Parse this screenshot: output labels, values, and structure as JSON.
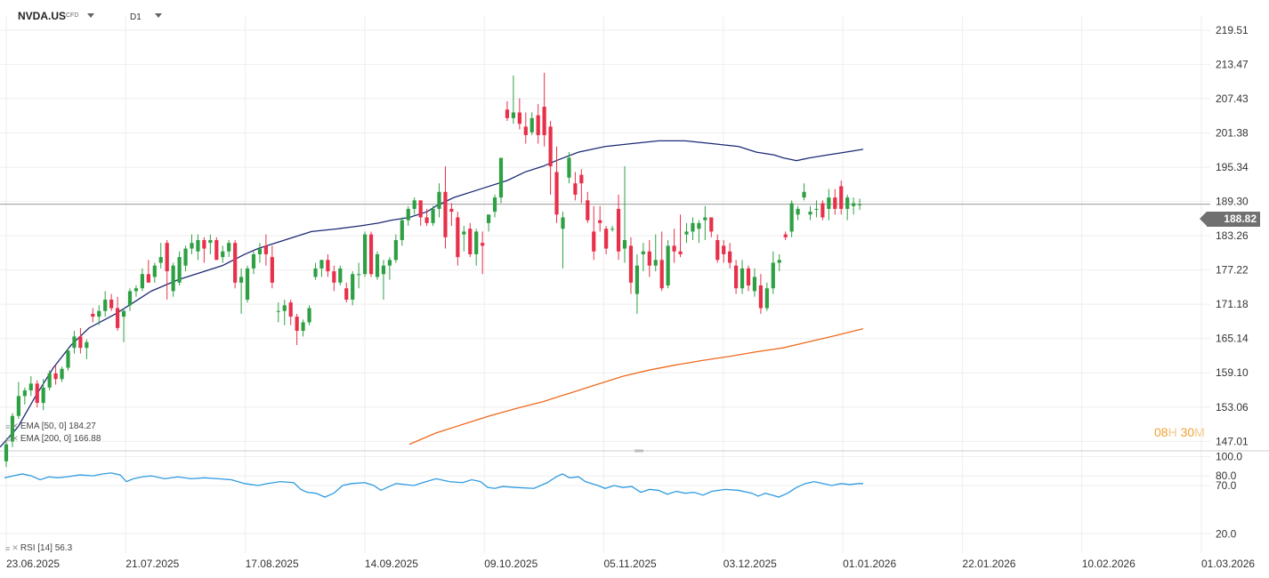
{
  "toolbar": {
    "symbol": "NVDA.US",
    "symbol_type": "CFD",
    "timeframe": "D1"
  },
  "colors": {
    "up": "#2ea043",
    "down": "#e8304a",
    "ema50": "#1c2a74",
    "ema200": "#ee6a1e",
    "rsi": "#2f9be0",
    "grid": "#eeeeee",
    "price_line": "#9a9a9a",
    "countdown": "#f0a030"
  },
  "icons": {
    "legend_drag": "lines-icon",
    "legend_remove": "close-icon",
    "dropdown": "caret-down-icon"
  },
  "legend": {
    "ema50": "EMA [50, 0]  184.27",
    "ema200": "EMA [200, 0]  166.88",
    "rsi": "RSI [14]  56.3"
  },
  "countdown": {
    "hours": "08",
    "hours_unit": "H",
    "minutes": "30",
    "minutes_unit": "M"
  },
  "current_price": "188.82",
  "chart_data": {
    "type": "candlestick",
    "title": "NVDA.US",
    "price_axis": {
      "ticks": [
        "219.51",
        "213.47",
        "207.43",
        "201.38",
        "195.34",
        "189.30",
        "183.26",
        "177.22",
        "171.18",
        "165.14",
        "159.10",
        "153.06",
        "147.01"
      ],
      "ylim": [
        145.5,
        222
      ]
    },
    "rsi_axis": {
      "ticks": [
        "100.0",
        "80.0",
        "70.0",
        "20.0"
      ],
      "ylim": [
        0,
        105
      ]
    },
    "x_axis": {
      "labels": [
        "23.06.2025",
        "21.07.2025",
        "17.08.2025",
        "14.09.2025",
        "09.10.2025",
        "05.11.2025",
        "03.12.2025",
        "01.01.2026",
        "22.01.2026",
        "10.02.2026",
        "01.03.2026"
      ]
    },
    "candles": [
      [
        143.5,
        147.0,
        142.5,
        146.5
      ],
      [
        147.0,
        152.0,
        146.0,
        151.5
      ],
      [
        151.5,
        157.5,
        151.0,
        155.0
      ],
      [
        155.0,
        156.5,
        153.5,
        156.0
      ],
      [
        156.0,
        158.5,
        155.0,
        157.2
      ],
      [
        157.2,
        157.8,
        153.0,
        153.8
      ],
      [
        153.8,
        158.0,
        152.5,
        156.5
      ],
      [
        156.5,
        159.5,
        156.0,
        159.0
      ],
      [
        159.0,
        160.5,
        157.0,
        158.0
      ],
      [
        158.0,
        160.2,
        157.5,
        159.8
      ],
      [
        160.0,
        163.5,
        159.5,
        163.0
      ],
      [
        163.5,
        166.5,
        162.5,
        165.5
      ],
      [
        165.5,
        167.0,
        162.5,
        163.5
      ],
      [
        163.5,
        165.0,
        161.5,
        164.5
      ],
      [
        169.5,
        170.5,
        168.0,
        169.0
      ],
      [
        169.0,
        171.0,
        167.5,
        170.0
      ],
      [
        170.0,
        173.5,
        169.0,
        172.0
      ],
      [
        172.0,
        173.0,
        170.0,
        170.5
      ],
      [
        170.5,
        172.5,
        166.5,
        167.0
      ],
      [
        169.0,
        170.5,
        164.5,
        170.0
      ],
      [
        171.0,
        174.0,
        170.0,
        173.5
      ],
      [
        173.5,
        174.5,
        172.5,
        174.0
      ],
      [
        174.0,
        177.5,
        173.5,
        176.5
      ],
      [
        176.5,
        179.0,
        175.5,
        175.0
      ],
      [
        176.0,
        178.5,
        175.0,
        178.0
      ],
      [
        178.5,
        182.0,
        177.5,
        179.5
      ],
      [
        182.0,
        182.5,
        172.0,
        177.0
      ],
      [
        173.5,
        178.5,
        172.5,
        178.0
      ],
      [
        175.0,
        180.5,
        174.5,
        179.5
      ],
      [
        178.0,
        181.5,
        177.0,
        181.0
      ],
      [
        181.0,
        183.5,
        180.0,
        182.0
      ],
      [
        180.5,
        183.5,
        179.0,
        182.5
      ],
      [
        182.5,
        183.0,
        178.5,
        181.0
      ],
      [
        182.0,
        183.5,
        180.0,
        182.5
      ],
      [
        182.5,
        183.0,
        179.0,
        179.0
      ],
      [
        179.5,
        181.5,
        178.5,
        180.5
      ],
      [
        180.5,
        182.5,
        179.5,
        182.0
      ],
      [
        182.0,
        182.5,
        174.0,
        175.0
      ],
      [
        175.0,
        177.5,
        169.5,
        176.0
      ],
      [
        172.0,
        178.0,
        171.5,
        177.5
      ],
      [
        177.5,
        180.5,
        176.5,
        180.0
      ],
      [
        180.0,
        182.0,
        178.5,
        181.0
      ],
      [
        181.5,
        183.5,
        178.0,
        180.0
      ],
      [
        179.5,
        181.5,
        174.0,
        175.0
      ],
      [
        170.0,
        171.5,
        168.0,
        170.0
      ],
      [
        170.0,
        172.0,
        167.5,
        171.0
      ],
      [
        171.5,
        172.0,
        167.5,
        169.0
      ],
      [
        169.0,
        169.5,
        164.0,
        166.5
      ],
      [
        166.5,
        168.5,
        165.5,
        168.0
      ],
      [
        168.0,
        171.0,
        167.5,
        170.5
      ],
      [
        176.0,
        178.5,
        175.5,
        177.5
      ],
      [
        177.5,
        179.0,
        176.0,
        179.0
      ],
      [
        179.0,
        180.0,
        176.0,
        177.0
      ],
      [
        177.0,
        178.0,
        173.5,
        175.0
      ],
      [
        175.0,
        178.0,
        174.5,
        177.5
      ],
      [
        174.0,
        175.0,
        171.5,
        172.0
      ],
      [
        172.0,
        177.0,
        171.0,
        176.5
      ],
      [
        176.5,
        178.5,
        174.0,
        176.5
      ],
      [
        176.5,
        184.0,
        176.0,
        183.5
      ],
      [
        183.5,
        184.0,
        176.0,
        176.5
      ],
      [
        176.0,
        180.5,
        175.5,
        180.0
      ],
      [
        176.5,
        179.0,
        172.0,
        178.0
      ],
      [
        178.0,
        179.5,
        175.5,
        179.0
      ],
      [
        179.0,
        183.5,
        178.5,
        182.5
      ],
      [
        182.5,
        186.5,
        181.5,
        186.0
      ],
      [
        186.0,
        188.5,
        185.0,
        188.0
      ],
      [
        188.0,
        190.0,
        187.0,
        189.5
      ],
      [
        189.5,
        189.5,
        185.0,
        186.5
      ],
      [
        186.5,
        188.0,
        185.0,
        185.5
      ],
      [
        185.5,
        188.5,
        185.0,
        188.0
      ],
      [
        188.0,
        192.5,
        186.5,
        191.0
      ],
      [
        191.0,
        195.5,
        181.0,
        183.0
      ],
      [
        188.0,
        189.0,
        185.0,
        187.5
      ],
      [
        186.5,
        187.5,
        178.0,
        179.5
      ],
      [
        183.5,
        185.0,
        180.5,
        184.0
      ],
      [
        184.5,
        185.5,
        179.5,
        180.0
      ],
      [
        180.0,
        184.5,
        178.0,
        184.0
      ],
      [
        182.0,
        184.0,
        176.5,
        181.5
      ],
      [
        185.5,
        187.0,
        184.0,
        187.0
      ],
      [
        187.5,
        190.5,
        186.5,
        190.0
      ],
      [
        190.0,
        197.0,
        189.0,
        197.0
      ],
      [
        205.5,
        207.0,
        203.5,
        204.0
      ],
      [
        204.0,
        211.5,
        203.0,
        205.0
      ],
      [
        205.0,
        207.5,
        202.0,
        203.0
      ],
      [
        202.5,
        205.0,
        199.5,
        201.0
      ],
      [
        201.5,
        205.0,
        201.0,
        204.0
      ],
      [
        204.5,
        206.5,
        199.5,
        201.0
      ],
      [
        206.0,
        212.0,
        199.0,
        201.0
      ],
      [
        202.5,
        203.5,
        190.5,
        195.5
      ],
      [
        194.5,
        199.0,
        185.5,
        187.0
      ],
      [
        184.5,
        187.5,
        177.5,
        186.5
      ],
      [
        193.5,
        198.0,
        192.5,
        197.0
      ],
      [
        192.5,
        194.5,
        189.5,
        190.5
      ],
      [
        194.0,
        195.0,
        189.0,
        192.5
      ],
      [
        189.5,
        191.0,
        185.5,
        186.0
      ],
      [
        184.0,
        188.5,
        179.0,
        180.5
      ],
      [
        186.0,
        188.5,
        184.0,
        185.5
      ],
      [
        184.5,
        185.0,
        180.0,
        181.0
      ],
      [
        184.5,
        185.0,
        184.0,
        184.5
      ],
      [
        188.0,
        190.5,
        179.0,
        180.5
      ],
      [
        181.0,
        195.5,
        178.5,
        182.5
      ],
      [
        181.5,
        183.0,
        173.0,
        175.0
      ],
      [
        173.0,
        180.0,
        169.5,
        178.0
      ],
      [
        180.0,
        182.0,
        177.0,
        180.5
      ],
      [
        180.5,
        182.5,
        176.0,
        178.0
      ],
      [
        178.0,
        183.5,
        177.0,
        179.0
      ],
      [
        179.0,
        184.0,
        173.5,
        174.0
      ],
      [
        174.5,
        182.5,
        174.0,
        181.5
      ],
      [
        181.5,
        184.5,
        178.5,
        180.5
      ],
      [
        180.5,
        187.0,
        179.5,
        180.0
      ],
      [
        183.5,
        185.5,
        182.0,
        184.0
      ],
      [
        184.0,
        186.5,
        182.5,
        185.5
      ],
      [
        184.5,
        186.0,
        182.0,
        185.5
      ],
      [
        186.0,
        188.5,
        182.5,
        186.5
      ],
      [
        186.5,
        186.5,
        183.0,
        184.0
      ],
      [
        182.5,
        183.5,
        178.5,
        179.0
      ],
      [
        181.5,
        182.5,
        178.5,
        180.0
      ],
      [
        180.5,
        182.0,
        177.5,
        178.5
      ],
      [
        178.0,
        179.0,
        173.0,
        174.0
      ],
      [
        174.0,
        179.0,
        173.0,
        177.5
      ],
      [
        177.5,
        178.0,
        173.5,
        174.5
      ],
      [
        173.5,
        177.5,
        172.5,
        176.0
      ],
      [
        174.5,
        176.5,
        169.5,
        170.5
      ],
      [
        170.5,
        175.0,
        170.0,
        174.0
      ],
      [
        174.0,
        180.5,
        173.0,
        178.5
      ],
      [
        178.5,
        180.0,
        177.0,
        179.0
      ],
      [
        183.5,
        184.0,
        182.5,
        183.0
      ],
      [
        184.0,
        189.5,
        183.0,
        189.0
      ],
      [
        187.0,
        188.5,
        186.0,
        188.0
      ],
      [
        190.0,
        192.5,
        189.5,
        191.0
      ],
      [
        187.0,
        188.5,
        186.0,
        187.5
      ],
      [
        188.0,
        189.5,
        186.5,
        188.0
      ],
      [
        189.0,
        189.5,
        186.0,
        186.5
      ],
      [
        188.0,
        191.5,
        186.0,
        190.0
      ],
      [
        190.0,
        191.5,
        187.0,
        188.0
      ],
      [
        192.0,
        193.0,
        187.0,
        188.0
      ],
      [
        188.0,
        190.5,
        186.0,
        190.0
      ],
      [
        188.5,
        190.0,
        187.0,
        189.0
      ],
      [
        188.8,
        189.8,
        187.8,
        188.8
      ]
    ],
    "ema50": [
      [
        0,
        146.0
      ],
      [
        20,
        149.5
      ],
      [
        40,
        155.0
      ],
      [
        60,
        160.0
      ],
      [
        80,
        164.0
      ],
      [
        100,
        167.0
      ],
      [
        130,
        169.5
      ],
      [
        150,
        171.5
      ],
      [
        170,
        173.5
      ],
      [
        200,
        175.5
      ],
      [
        220,
        176.5
      ],
      [
        250,
        178.0
      ],
      [
        275,
        180.0
      ],
      [
        290,
        181.0
      ],
      [
        310,
        182.0
      ],
      [
        330,
        183.0
      ],
      [
        350,
        184.0
      ],
      [
        380,
        184.5
      ],
      [
        405,
        185.0
      ],
      [
        425,
        185.5
      ],
      [
        440,
        186.0
      ],
      [
        460,
        186.5
      ],
      [
        480,
        187.5
      ],
      [
        490,
        188.5
      ],
      [
        510,
        190.0
      ],
      [
        540,
        191.5
      ],
      [
        570,
        193.0
      ],
      [
        590,
        194.5
      ],
      [
        610,
        195.5
      ],
      [
        625,
        196.5
      ],
      [
        650,
        198.0
      ],
      [
        680,
        199.0
      ],
      [
        710,
        199.5
      ],
      [
        740,
        200.0
      ],
      [
        770,
        200.0
      ],
      [
        800,
        199.5
      ],
      [
        830,
        199.0
      ],
      [
        850,
        198.0
      ],
      [
        870,
        197.5
      ],
      [
        880,
        197.0
      ],
      [
        895,
        196.5
      ],
      [
        910,
        197.0
      ],
      [
        930,
        197.5
      ],
      [
        950,
        198.0
      ],
      [
        970,
        198.5
      ]
    ],
    "ema200": [
      [
        460,
        146.5
      ],
      [
        490,
        148.5
      ],
      [
        520,
        150.0
      ],
      [
        550,
        151.5
      ],
      [
        580,
        152.8
      ],
      [
        610,
        154.0
      ],
      [
        640,
        155.5
      ],
      [
        670,
        157.0
      ],
      [
        700,
        158.5
      ],
      [
        730,
        159.6
      ],
      [
        760,
        160.5
      ],
      [
        790,
        161.3
      ],
      [
        820,
        162.0
      ],
      [
        850,
        162.8
      ],
      [
        880,
        163.5
      ],
      [
        910,
        164.6
      ],
      [
        940,
        165.7
      ],
      [
        970,
        166.88
      ]
    ],
    "rsi": [
      [
        5,
        78
      ],
      [
        15,
        80
      ],
      [
        25,
        82
      ],
      [
        35,
        80
      ],
      [
        45,
        76
      ],
      [
        55,
        79
      ],
      [
        65,
        78
      ],
      [
        75,
        79
      ],
      [
        90,
        81
      ],
      [
        105,
        80
      ],
      [
        115,
        82
      ],
      [
        125,
        83
      ],
      [
        135,
        81
      ],
      [
        142,
        74
      ],
      [
        150,
        77
      ],
      [
        160,
        79
      ],
      [
        170,
        80
      ],
      [
        185,
        77
      ],
      [
        200,
        79
      ],
      [
        215,
        77
      ],
      [
        230,
        78
      ],
      [
        245,
        77
      ],
      [
        260,
        76
      ],
      [
        275,
        72
      ],
      [
        290,
        70
      ],
      [
        300,
        72
      ],
      [
        315,
        74
      ],
      [
        330,
        73
      ],
      [
        338,
        66
      ],
      [
        345,
        63
      ],
      [
        355,
        62
      ],
      [
        365,
        58
      ],
      [
        375,
        62
      ],
      [
        385,
        70
      ],
      [
        395,
        72
      ],
      [
        410,
        73
      ],
      [
        420,
        70
      ],
      [
        428,
        65
      ],
      [
        435,
        68
      ],
      [
        445,
        72
      ],
      [
        455,
        71
      ],
      [
        465,
        70
      ],
      [
        475,
        73
      ],
      [
        490,
        77
      ],
      [
        505,
        74
      ],
      [
        520,
        73
      ],
      [
        530,
        76
      ],
      [
        540,
        74
      ],
      [
        548,
        68
      ],
      [
        556,
        67
      ],
      [
        565,
        69
      ],
      [
        580,
        68
      ],
      [
        600,
        67
      ],
      [
        615,
        73
      ],
      [
        625,
        79
      ],
      [
        632,
        82
      ],
      [
        640,
        78
      ],
      [
        650,
        79
      ],
      [
        658,
        74
      ],
      [
        665,
        72
      ],
      [
        672,
        70
      ],
      [
        680,
        67
      ],
      [
        690,
        70
      ],
      [
        700,
        68
      ],
      [
        710,
        69
      ],
      [
        720,
        63
      ],
      [
        730,
        66
      ],
      [
        740,
        65
      ],
      [
        750,
        61
      ],
      [
        760,
        64
      ],
      [
        770,
        62
      ],
      [
        780,
        63
      ],
      [
        790,
        60
      ],
      [
        800,
        64
      ],
      [
        815,
        66
      ],
      [
        830,
        65
      ],
      [
        845,
        62
      ],
      [
        852,
        59
      ],
      [
        860,
        62
      ],
      [
        868,
        60
      ],
      [
        875,
        58
      ],
      [
        885,
        62
      ],
      [
        895,
        68
      ],
      [
        905,
        72
      ],
      [
        915,
        74
      ],
      [
        925,
        72
      ],
      [
        935,
        70
      ],
      [
        945,
        72
      ],
      [
        955,
        71
      ],
      [
        965,
        72
      ],
      [
        970,
        72
      ]
    ]
  }
}
